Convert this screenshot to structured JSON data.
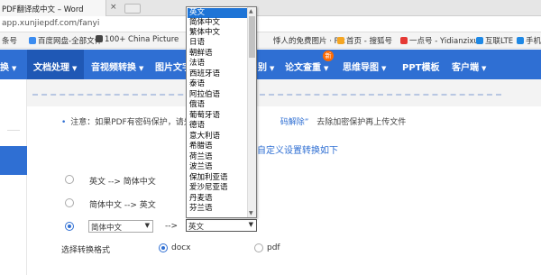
{
  "browser": {
    "tab_title": "PDF翻译成中文 – Word",
    "tab_close": "×",
    "url": "app.xunjiepdf.com/fanyi"
  },
  "bookmarks": [
    {
      "label": "条号",
      "color": "#999999"
    },
    {
      "label": "百度网盘-全部文件",
      "color": "#3b8cf0"
    },
    {
      "label": "100+ China Picture",
      "color": "#444444"
    },
    {
      "label": "悸人的免费图片 · Pix",
      "color": "#7cb342"
    },
    {
      "label": "首页 - 搜狐号",
      "color": "#f5a623"
    },
    {
      "label": "一点号 - Yidianzixu",
      "color": "#e53935"
    },
    {
      "label": "互联LTE",
      "color": "#1e88e5"
    },
    {
      "label": "手机数据",
      "color": "#1e88e5"
    }
  ],
  "nav": {
    "items": [
      {
        "label": "换",
        "has_caret": true
      },
      {
        "label": "文档处理",
        "has_caret": true
      },
      {
        "label": "音视频转换",
        "has_caret": true
      },
      {
        "label": "图片文字",
        "has_caret": false
      },
      {
        "label": "别",
        "has_caret": true
      },
      {
        "label": "论文查重",
        "has_caret": true
      },
      {
        "label": "思维导图",
        "has_caret": true
      },
      {
        "label": "PPT模板",
        "has_caret": false
      },
      {
        "label": "客户端",
        "has_caret": true
      }
    ],
    "badge": "新",
    "accent": "#2f6fd3"
  },
  "notice": {
    "prefix": "注意：如果PDF有密码保护，请先",
    "link": "码解除”",
    "suffix": "去除加密保护再上传文件"
  },
  "settings_title": "自定义设置转换如下",
  "options": [
    {
      "label": "英文  -->  简体中文",
      "selected": false
    },
    {
      "label": "简体中文  -->  英文",
      "selected": false
    }
  ],
  "custom_option": {
    "source_value": "简体中文",
    "arrow": "-->",
    "target_value": "英文",
    "selected": true
  },
  "format": {
    "label": "选择转换格式",
    "options": [
      {
        "label": "docx",
        "selected": true
      },
      {
        "label": "pdf",
        "selected": false
      }
    ]
  },
  "dropdown_options": [
    "英文",
    "简体中文",
    "繁体中文",
    "日语",
    "朝鲜语",
    "法语",
    "西班牙语",
    "泰语",
    "阿拉伯语",
    "俄语",
    "葡萄牙语",
    "德语",
    "意大利语",
    "希腊语",
    "荷兰语",
    "波兰语",
    "保加利亚语",
    "爱沙尼亚语",
    "丹麦语",
    "芬兰语"
  ],
  "dropdown_selected": "英文"
}
